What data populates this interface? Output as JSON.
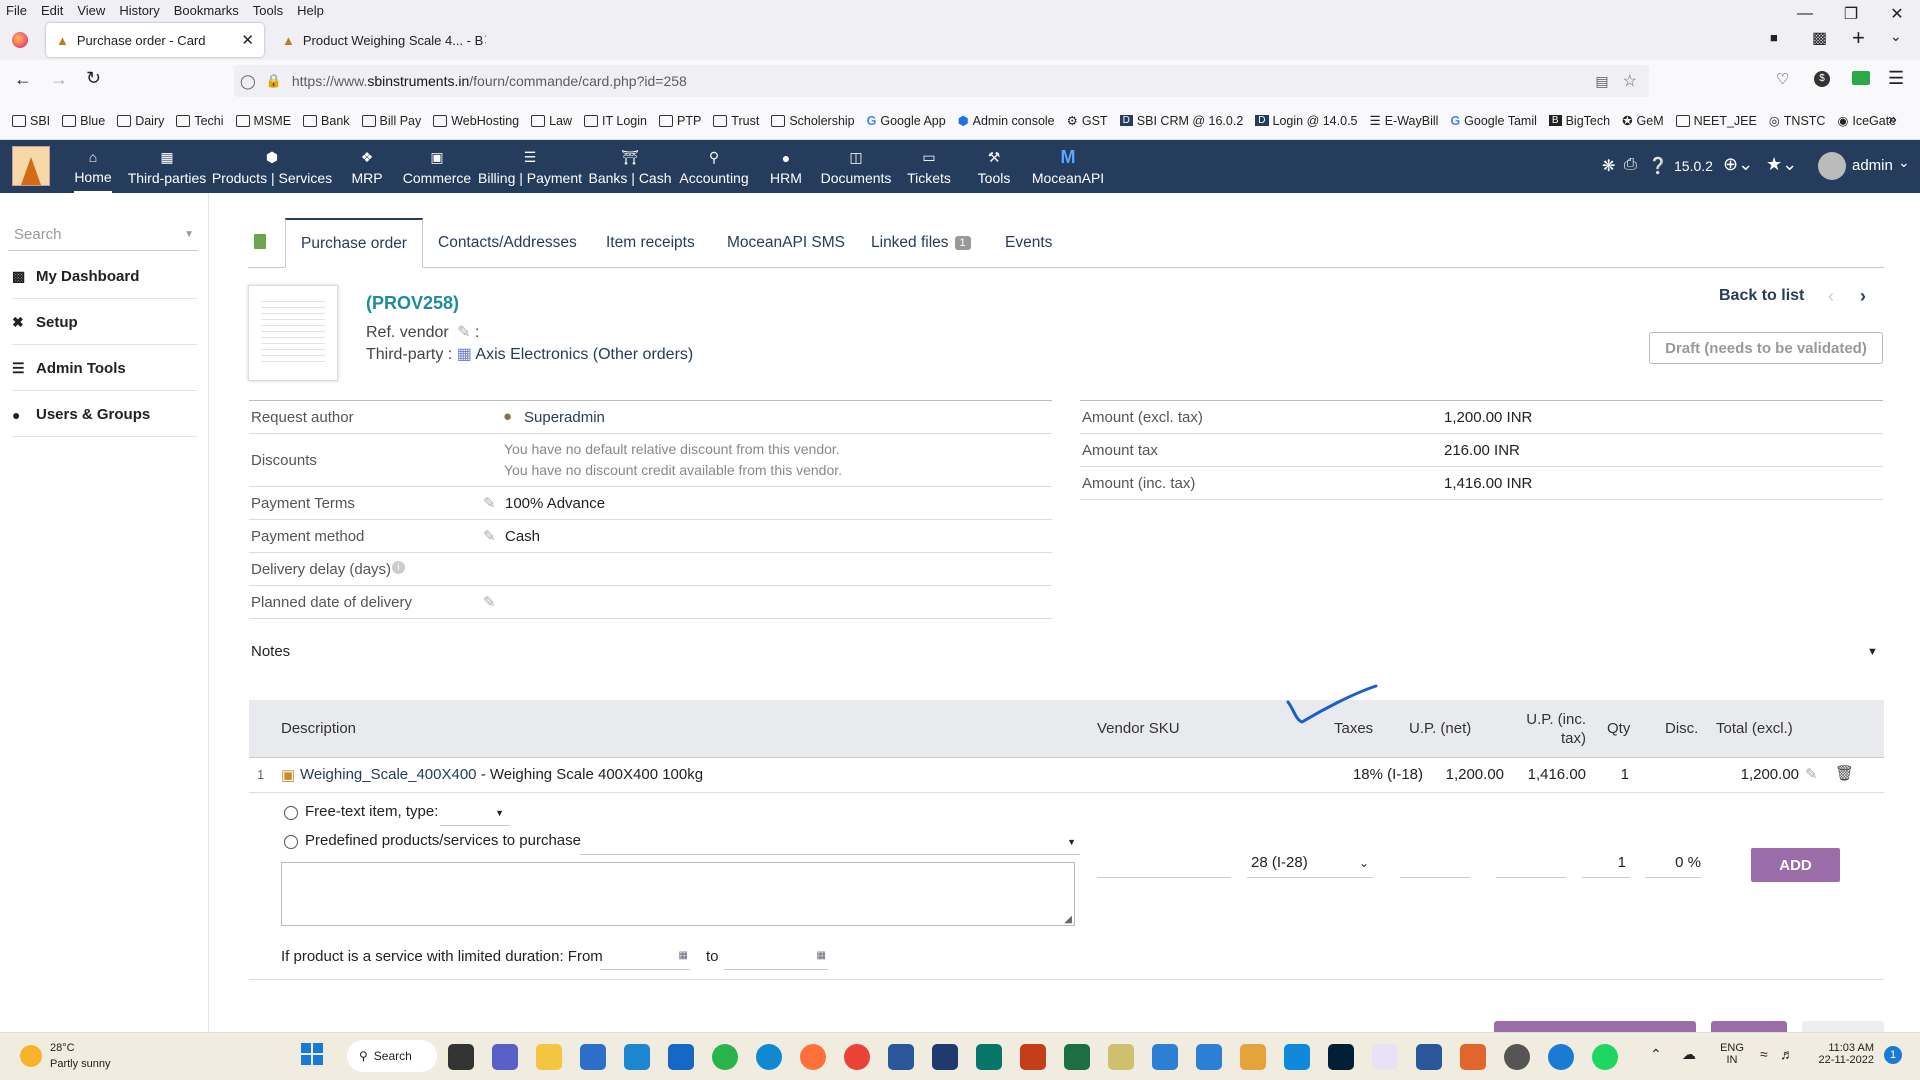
{
  "browser": {
    "menu": [
      "File",
      "Edit",
      "View",
      "History",
      "Bookmarks",
      "Tools",
      "Help"
    ],
    "tabs": [
      {
        "title": "Purchase order - Card",
        "active": true
      },
      {
        "title": "Product Weighing Scale 4... - B",
        "active": false
      }
    ],
    "url_prefix": "https://www.",
    "url_domain": "sbinstruments.in",
    "url_path": "/fourn/commande/card.php?id=258",
    "bookmarks": [
      "SBI",
      "Blue",
      "Dairy",
      "Techi",
      "MSME",
      "Bank",
      "Bill Pay",
      "WebHosting",
      "Law",
      "IT Login",
      "PTP",
      "Trust",
      "Scholership",
      "Google App",
      "Admin console",
      "GST",
      "SBI CRM @ 16.0.2",
      "Login @ 14.0.5",
      "E-WayBill",
      "Google Tamil",
      "BigTech",
      "GeM",
      "NEET_JEE",
      "TNSTC",
      "IceGate"
    ]
  },
  "topmenu": {
    "items": [
      "Home",
      "Third-parties",
      "Products | Services",
      "MRP",
      "Commerce",
      "Billing | Payment",
      "Banks | Cash",
      "Accounting",
      "HRM",
      "Documents",
      "Tickets",
      "Tools",
      "MoceanAPI"
    ],
    "version": "15.0.2",
    "user": "admin",
    "colors": {
      "bar": "#263c5c",
      "accent": "#9b6da8"
    }
  },
  "sidebar": {
    "search_placeholder": "Search",
    "items": [
      "My Dashboard",
      "Setup",
      "Admin Tools",
      "Users & Groups"
    ]
  },
  "tabs": [
    "Purchase order",
    "Contacts/Addresses",
    "Item receipts",
    "MoceanAPI SMS",
    "Linked files",
    "Events"
  ],
  "linked_files_count": "1",
  "header": {
    "ref": "(PROV258)",
    "ref_vendor_label": "Ref. vendor",
    "third_party_label": "Third-party :",
    "third_party": "Axis Electronics",
    "other_orders": "(Other orders)",
    "back_to_list": "Back to list",
    "status": "Draft (needs to be validated)"
  },
  "fields": {
    "request_author_label": "Request author",
    "request_author": "Superadmin",
    "discounts_label": "Discounts",
    "discount_note1": "You have no default relative discount from this vendor.",
    "discount_note2": "You have no discount credit available from this vendor.",
    "payment_terms_label": "Payment Terms",
    "payment_terms": "100% Advance",
    "payment_method_label": "Payment method",
    "payment_method": "Cash",
    "delivery_delay_label": "Delivery delay (days)",
    "planned_date_label": "Planned date of delivery"
  },
  "amounts": {
    "excl_label": "Amount (excl. tax)",
    "excl": "1,200.00 INR",
    "tax_label": "Amount tax",
    "tax": "216.00 INR",
    "inc_label": "Amount (inc. tax)",
    "inc": "1,416.00 INR"
  },
  "notes_label": "Notes",
  "lines": {
    "headers": {
      "description": "Description",
      "vendor_sku": "Vendor SKU",
      "taxes": "Taxes",
      "up_net": "U.P. (net)",
      "up_inc1": "U.P. (inc.",
      "up_inc2": "tax)",
      "qty": "Qty",
      "disc": "Disc.",
      "total": "Total (excl.)"
    },
    "rows": [
      {
        "num": "1",
        "product_ref": "Weighing_Scale_400X400",
        "product_desc": " - Weighing Scale 400X400 100kg",
        "tax": "18% (I-18)",
        "up_net": "1,200.00",
        "up_inc": "1,416.00",
        "qty": "1",
        "total": "1,200.00"
      }
    ]
  },
  "addline": {
    "free_text_label": "Free-text item, type:",
    "predefined_label": "Predefined products/services to purchase",
    "tax_select": "28 (I-28)",
    "qty": "1",
    "disc": "0 %",
    "add_button": "ADD",
    "service_label": "If product is a service with limited duration: From",
    "to_label": "to"
  },
  "taskbar": {
    "temp": "28°C",
    "weather": "Partly sunny",
    "search": "Search",
    "lang1": "ENG",
    "lang2": "IN",
    "time": "11:03 AM",
    "date": "22-11-2022",
    "notif": "1"
  }
}
